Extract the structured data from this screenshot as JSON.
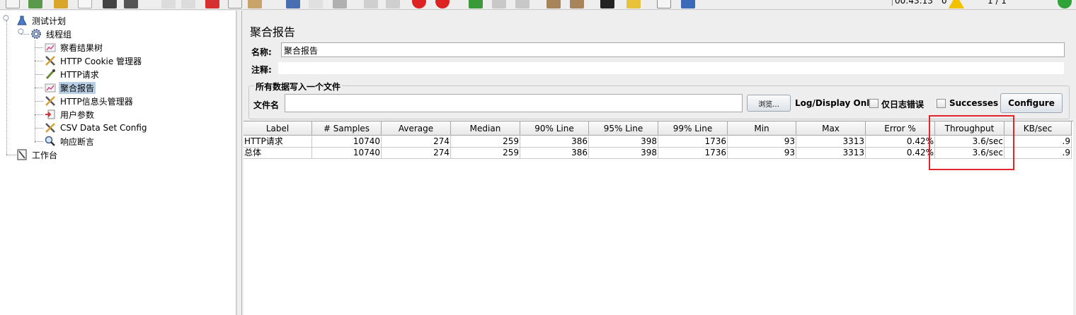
{
  "toolbar": {
    "elapsed_time": "00:43:13",
    "error_count": "0",
    "thread_ratio": "1 / 1"
  },
  "tree": {
    "nodes": [
      {
        "label": "测试计划",
        "icon": "test-plan-icon"
      },
      {
        "label": "线程组",
        "icon": "thread-group-gear-icon"
      },
      {
        "label": "察看结果树",
        "icon": "view-results-tree-icon"
      },
      {
        "label": "HTTP Cookie 管理器",
        "icon": "config-element-icon"
      },
      {
        "label": "HTTP请求",
        "icon": "sampler-dropper-icon"
      },
      {
        "label": "聚合报告",
        "icon": "aggregate-report-icon"
      },
      {
        "label": "HTTP信息头管理器",
        "icon": "config-element-icon"
      },
      {
        "label": "用户参数",
        "icon": "pre-processor-icon"
      },
      {
        "label": "CSV Data Set Config",
        "icon": "config-element-icon"
      },
      {
        "label": "响应断言",
        "icon": "assertion-magnifier-icon"
      },
      {
        "label": "工作台",
        "icon": "workbench-icon"
      }
    ]
  },
  "panel": {
    "title": "聚合报告",
    "name_label": "名称:",
    "name_value": "聚合报告",
    "comment_label": "注释:",
    "comment_value": "",
    "fieldset_legend": "所有数据写入一个文件",
    "filename_label": "文件名",
    "filename_value": "",
    "browse_button": "浏览...",
    "log_display_label": "Log/Display Only:",
    "errors_only_label": "仅日志错误",
    "successes_label": "Successes",
    "configure_button": "Configure"
  },
  "table": {
    "columns": [
      "Label",
      "# Samples",
      "Average",
      "Median",
      "90% Line",
      "95% Line",
      "99% Line",
      "Min",
      "Max",
      "Error %",
      "Throughput",
      "KB/sec"
    ],
    "rows": [
      [
        "HTTP请求",
        "10740",
        "274",
        "259",
        "386",
        "398",
        "1736",
        "93",
        "3313",
        "0.42%",
        "3.6/sec",
        ".9"
      ],
      [
        "总体",
        "10740",
        "274",
        "259",
        "386",
        "398",
        "1736",
        "93",
        "3313",
        "0.42%",
        "3.6/sec",
        ".9"
      ]
    ]
  },
  "colors": {
    "selection": "#b8cfe5",
    "highlight_box": "#e0262a"
  }
}
